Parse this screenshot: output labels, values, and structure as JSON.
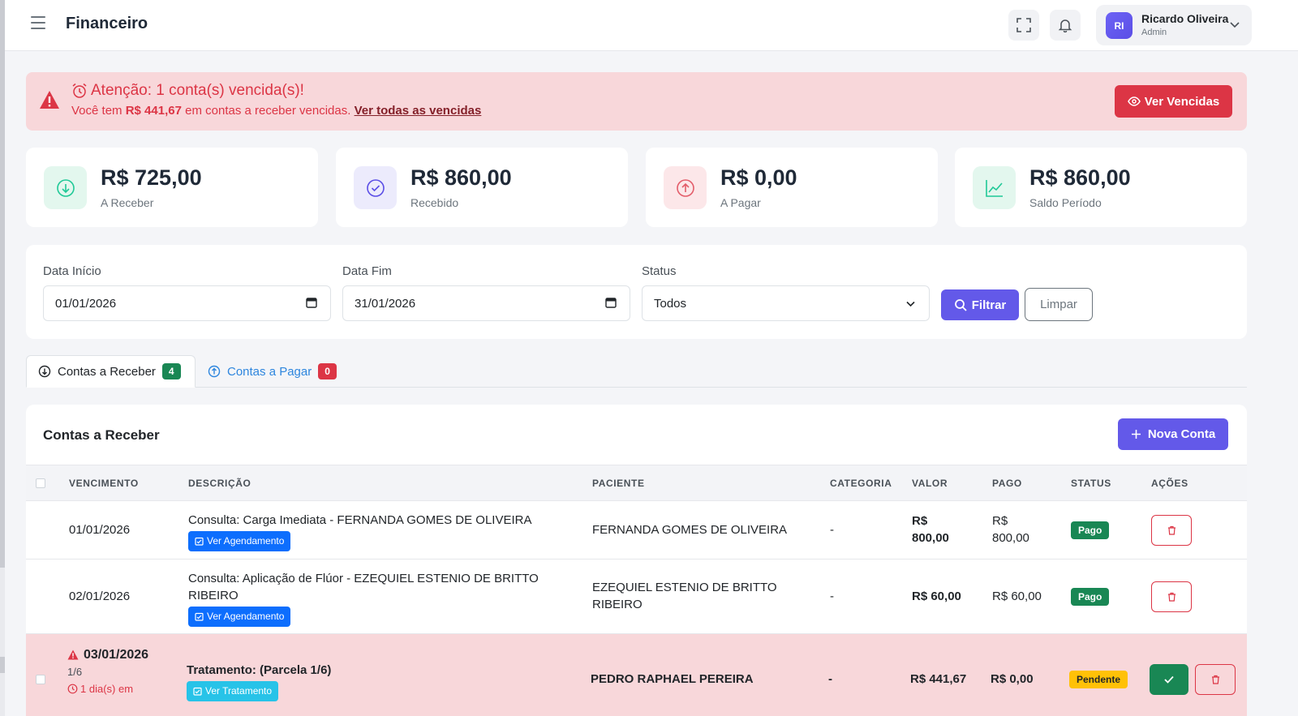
{
  "header": {
    "title": "Financeiro",
    "user_initials": "RI",
    "user_name": "Ricardo Oliveira",
    "user_role": "Admin"
  },
  "alert": {
    "title": "Atenção: 1 conta(s) vencida(s)!",
    "text_prefix": "Você tem",
    "amount": "R$ 441,67",
    "text_suffix": "em contas a receber vencidas.",
    "link": "Ver todas as vencidas",
    "button": "Ver Vencidas"
  },
  "stats": [
    {
      "value": "R$ 725,00",
      "label": "A Receber",
      "icon": "arrow-down-circle-icon",
      "color": "#20c997"
    },
    {
      "value": "R$ 860,00",
      "label": "Recebido",
      "icon": "check-circle-icon",
      "color": "#5b4ee6"
    },
    {
      "value": "R$ 0,00",
      "label": "A Pagar",
      "icon": "arrow-up-circle-icon",
      "color": "#e35d6a"
    },
    {
      "value": "R$ 860,00",
      "label": "Saldo Período",
      "icon": "chart-line-icon",
      "color": "#20c997"
    }
  ],
  "filters": {
    "start_label": "Data Início",
    "start_value": "01/01/2026",
    "end_label": "Data Fim",
    "end_value": "31/01/2026",
    "status_label": "Status",
    "status_value": "Todos",
    "filter_button": "Filtrar",
    "clear_button": "Limpar"
  },
  "tabs": [
    {
      "label": "Contas a Receber",
      "count": "4"
    },
    {
      "label": "Contas a Pagar",
      "count": "0"
    }
  ],
  "table": {
    "title": "Contas a Receber",
    "new_button": "Nova Conta",
    "columns": [
      "VENCIMENTO",
      "DESCRIÇÃO",
      "PACIENTE",
      "CATEGORIA",
      "VALOR",
      "PAGO",
      "STATUS",
      "AÇÕES"
    ],
    "rows": [
      {
        "due": "01/01/2026",
        "desc_line1": "Consulta: Carga Imediata - FERNANDA GOMES DE OLIVEIRA",
        "desc_line2": "",
        "link": "Ver Agendamento",
        "patient_line1": "FERNANDA GOMES DE OLIVEIRA",
        "patient_line2": "",
        "category": "-",
        "value_line1": "R$",
        "value_line2": "800,00",
        "paid_line1": "R$",
        "paid_line2": "800,00",
        "status": "Pago"
      },
      {
        "due": "02/01/2026",
        "desc_line1": "Consulta: Aplicação de Flúor - EZEQUIEL ESTENIO DE BRITTO",
        "desc_line2": "RIBEIRO",
        "link": "Ver Agendamento",
        "patient_line1": "EZEQUIEL ESTENIO DE BRITTO",
        "patient_line2": "RIBEIRO",
        "category": "-",
        "value": "R$ 60,00",
        "paid": "R$ 60,00",
        "status": "Pago"
      },
      {
        "due": "03/01/2026",
        "installment": "1/6",
        "overdue": "1 dia(s) em",
        "desc_line1": "Tratamento: (Parcela 1/6)",
        "link": "Ver Tratamento",
        "patient": "PEDRO RAPHAEL PEREIRA",
        "category": "-",
        "value": "R$ 441,67",
        "paid": "R$ 0,00",
        "status": "Pendente"
      }
    ]
  }
}
